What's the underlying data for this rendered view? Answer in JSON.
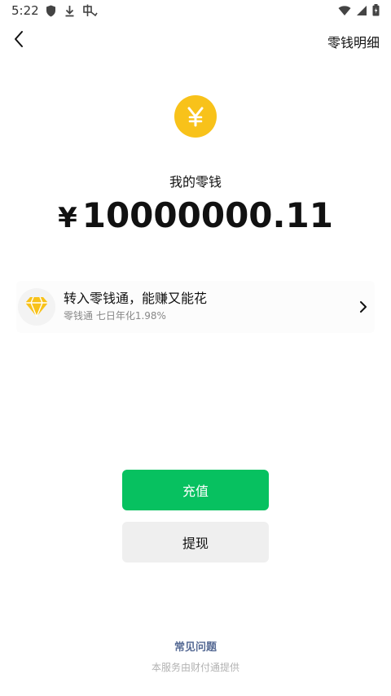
{
  "status_bar": {
    "time": "5:22",
    "icons_left": [
      "shield-icon",
      "download-icon",
      "notification-icon"
    ],
    "icons_right": [
      "wifi-icon",
      "signal-icon",
      "battery-icon"
    ]
  },
  "nav": {
    "back_icon": "chevron-left-icon",
    "detail_label": "零钱明细"
  },
  "balance": {
    "icon": "yuan-coin-icon",
    "label": "我的零钱",
    "currency": "¥",
    "amount": "10000000.11",
    "icon_color": "#f8c21a"
  },
  "promo": {
    "icon": "diamond-icon",
    "title": "转入零钱通，能赚又能花",
    "subtitle": "零钱通 七日年化1.98%",
    "chevron": "chevron-right-icon"
  },
  "actions": {
    "topup_label": "充值",
    "withdraw_label": "提现",
    "topup_color": "#07c160",
    "withdraw_color": "#efefef"
  },
  "footer": {
    "faq_label": "常见问题",
    "provider_note": "本服务由财付通提供",
    "link_color": "#576b95"
  }
}
